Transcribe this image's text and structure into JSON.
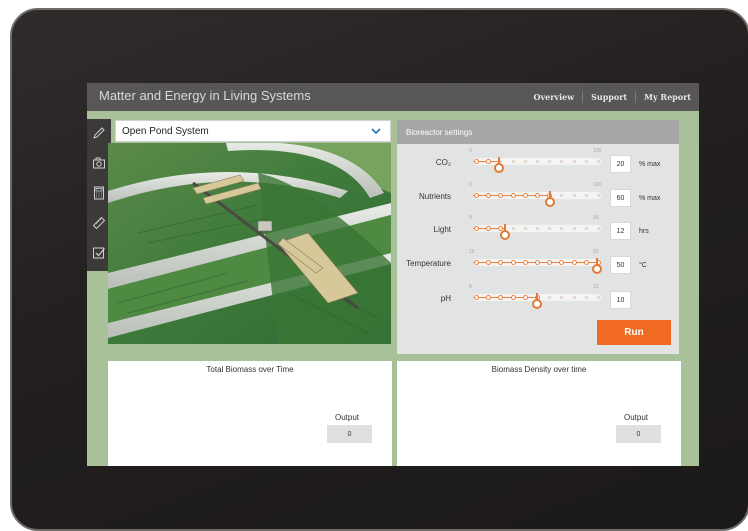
{
  "app": {
    "title": "Matter and Energy in Living Systems",
    "nav": [
      "Overview",
      "Support",
      "My Report"
    ]
  },
  "toolbar": {
    "icons": [
      "pencil-icon",
      "camera-icon",
      "calculator-icon",
      "ruler-icon",
      "checkbox-icon"
    ]
  },
  "system_select": {
    "value": "Open Pond System",
    "icon": "chevron-down-icon"
  },
  "bioreactor": {
    "header": "Bioreactor settings",
    "sliders": [
      {
        "label": "CO₂",
        "min": "0",
        "max": "100",
        "value": "20",
        "fraction": 0.2,
        "unit": "% max"
      },
      {
        "label": "Nutrients",
        "min": "0",
        "max": "100",
        "value": "60",
        "fraction": 0.6,
        "unit": "% max"
      },
      {
        "label": "Light",
        "min": "8",
        "max": "24",
        "value": "12",
        "fraction": 0.25,
        "unit": "hrs"
      },
      {
        "label": "Temperature",
        "min": "15",
        "max": "50",
        "value": "50",
        "fraction": 1.0,
        "unit": "°C"
      },
      {
        "label": "pH",
        "min": "8",
        "max": "12",
        "value": "10",
        "fraction": 0.5,
        "unit": ""
      }
    ],
    "run_label": "Run",
    "accent_color": "#f06a22"
  },
  "charts": [
    {
      "title": "Total Biomass over Time",
      "output_label": "Output",
      "output_value": "0"
    },
    {
      "title": "Biomass Density over time",
      "output_label": "Output",
      "output_value": "0"
    }
  ]
}
